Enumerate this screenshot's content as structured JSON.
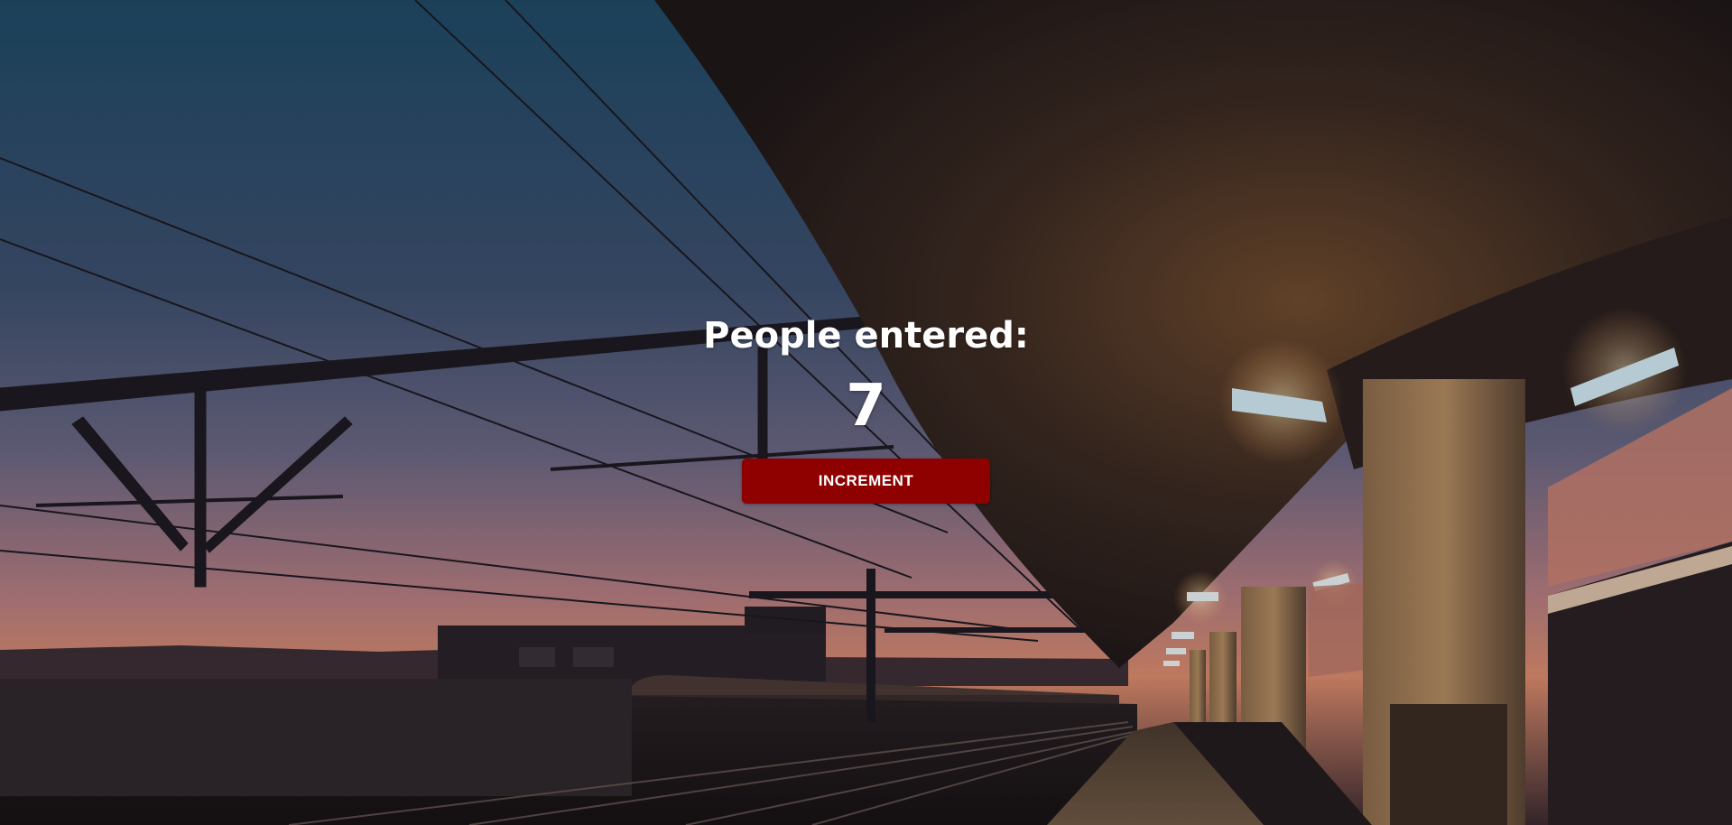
{
  "counter": {
    "title": "People entered:",
    "count": "7",
    "button_label": "INCREMENT"
  },
  "colors": {
    "button_bg": "#8f0000",
    "text": "#ffffff",
    "sky_top": "#1f4a66",
    "sky_mid": "#5a5f7e",
    "sky_bottom": "#d98a6c",
    "canopy": "#2a1e1c",
    "lamp": "#cfe6f0"
  },
  "background": {
    "scene": "train-station-platform-at-dusk"
  }
}
